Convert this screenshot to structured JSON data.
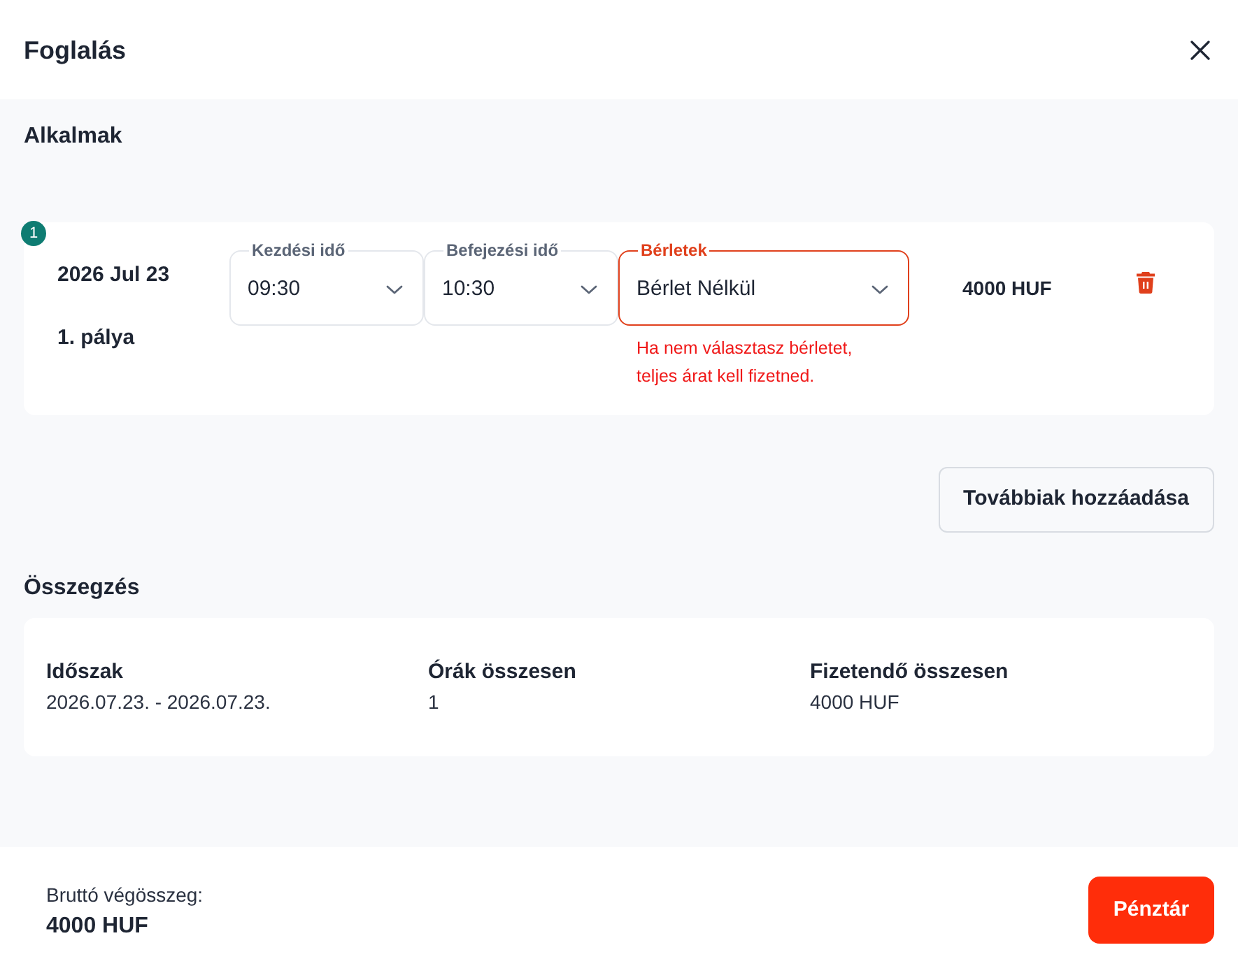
{
  "dialog": {
    "title": "Foglalás"
  },
  "sessions_section": {
    "heading": "Alkalmak",
    "sessions": [
      {
        "number": "1",
        "date": "2026 Jul 23",
        "court": "1. pálya",
        "fields": [
          {
            "label": "Kezdési idő",
            "value": "09:30",
            "invalid": false
          },
          {
            "label": "Befejezési idő",
            "value": "10:30",
            "invalid": false
          },
          {
            "label": "Bérletek",
            "value": "Bérlet Nélkül",
            "invalid": true,
            "helper": "Ha nem választasz bérletet, teljes árat kell fizetned."
          }
        ],
        "price": "4000 HUF"
      }
    ],
    "add_button": "Továbbiak hozzáadása"
  },
  "summary": {
    "heading": "Összegzés",
    "items": [
      {
        "label": "Időszak",
        "value": "2026.07.23. - 2026.07.23."
      },
      {
        "label": "Órák összesen",
        "value": "1"
      },
      {
        "label": "Fizetendő összesen",
        "value": "4000 HUF"
      }
    ]
  },
  "footer": {
    "total_label": "Bruttó végösszeg:",
    "total": "4000 HUF",
    "checkout_button": "Pénztár"
  }
}
